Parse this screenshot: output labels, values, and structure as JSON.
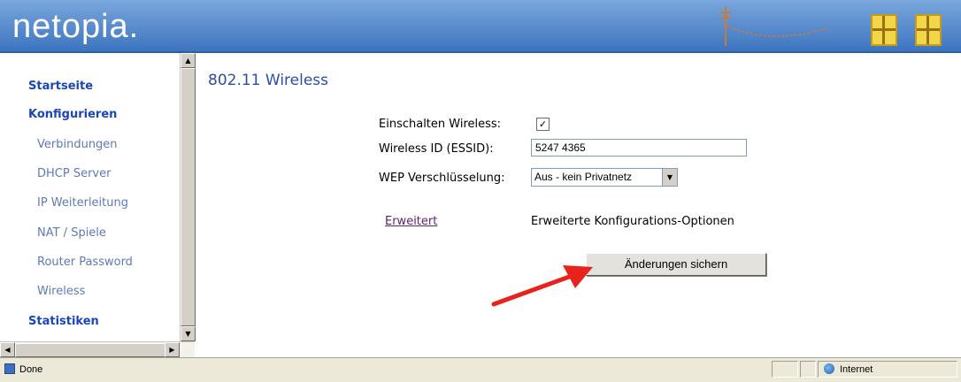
{
  "header": {
    "logo": "netopia."
  },
  "sidebar": {
    "items": [
      {
        "label": "Startseite",
        "type": "main"
      },
      {
        "label": "Konfigurieren",
        "type": "main"
      },
      {
        "label": "Verbindungen",
        "type": "sub"
      },
      {
        "label": "DHCP Server",
        "type": "sub"
      },
      {
        "label": "IP Weiterleitung",
        "type": "sub"
      },
      {
        "label": "NAT / Spiele",
        "type": "sub"
      },
      {
        "label": "Router Password",
        "type": "sub"
      },
      {
        "label": "Wireless",
        "type": "sub"
      },
      {
        "label": "Statistiken",
        "type": "main"
      }
    ]
  },
  "main": {
    "title": "802.11 Wireless",
    "enable_label": "Einschalten Wireless:",
    "enable_checked": true,
    "essid_label": "Wireless ID (ESSID):",
    "essid_value": "5247 4365",
    "wep_label": "WEP Verschlüsselung:",
    "wep_value": "Aus - kein Privatnetz",
    "advanced_link": "Erweitert",
    "advanced_desc": "Erweiterte Konfigurations-Optionen",
    "save_button": "Änderungen sichern"
  },
  "statusbar": {
    "left_text": "Done",
    "zone_text": "Internet"
  },
  "colors": {
    "header_blue": "#4f84c9",
    "link_blue": "#1b46b8",
    "arrow_red": "#e8221c"
  }
}
